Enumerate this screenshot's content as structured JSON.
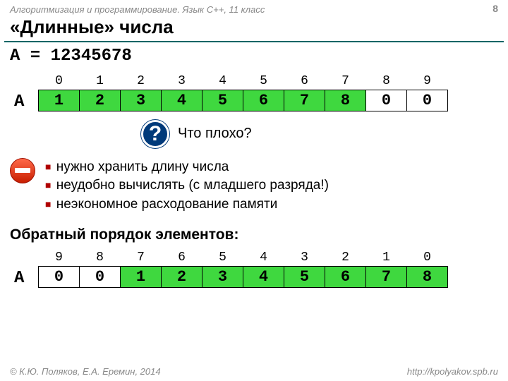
{
  "header": "Алгоритмизация и программирование. Язык C++, 11 класс",
  "pagenum": "8",
  "title": "«Длинные» числа",
  "equation": "A = 12345678",
  "table1": {
    "label": "A",
    "idx": [
      "0",
      "1",
      "2",
      "3",
      "4",
      "5",
      "6",
      "7",
      "8",
      "9"
    ],
    "cells": [
      "1",
      "2",
      "3",
      "4",
      "5",
      "6",
      "7",
      "8",
      "0",
      "0"
    ],
    "green_upto": 8
  },
  "question": {
    "mark": "?",
    "text": "Что плохо?"
  },
  "bullets": [
    "нужно хранить длину числа",
    "неудобно вычислять (с младшего разряда!)",
    "неэкономное расходование памяти"
  ],
  "subheading": "Обратный порядок элементов:",
  "table2": {
    "label": "A",
    "idx": [
      "9",
      "8",
      "7",
      "6",
      "5",
      "4",
      "3",
      "2",
      "1",
      "0"
    ],
    "cells": [
      "0",
      "0",
      "1",
      "2",
      "3",
      "4",
      "5",
      "6",
      "7",
      "8"
    ],
    "green_from": 2
  },
  "footer": {
    "left": "© К.Ю. Поляков, Е.А. Еремин, 2014",
    "right": "http://kpolyakov.spb.ru"
  }
}
